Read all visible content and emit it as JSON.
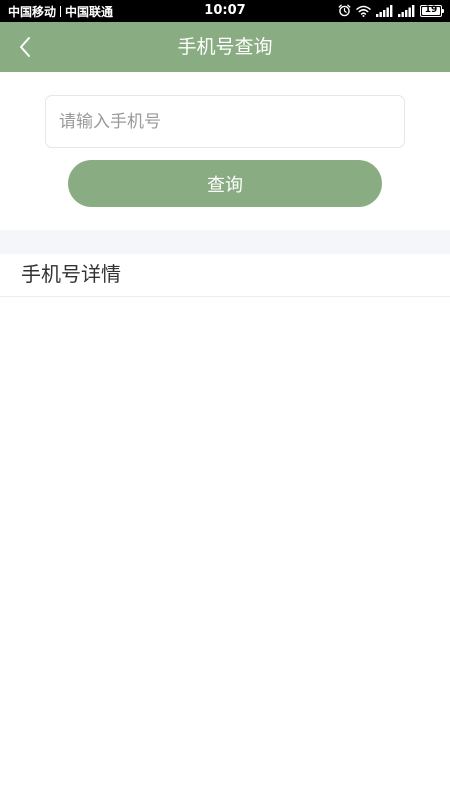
{
  "status_bar": {
    "carrier_1": "中国移动",
    "carrier_2": "中国联通",
    "time": "10:07",
    "battery_level": "19",
    "icons": [
      "alarm-icon",
      "wifi-icon",
      "signal-icon",
      "signal-icon",
      "battery-icon"
    ]
  },
  "header": {
    "title": "手机号查询",
    "back_icon": "chevron-left-icon",
    "background_color": "#8aac82"
  },
  "search": {
    "input_value": "",
    "input_placeholder": "请输入手机号",
    "button_label": "查询",
    "button_color": "#8aac82"
  },
  "details": {
    "title": "手机号详情"
  }
}
